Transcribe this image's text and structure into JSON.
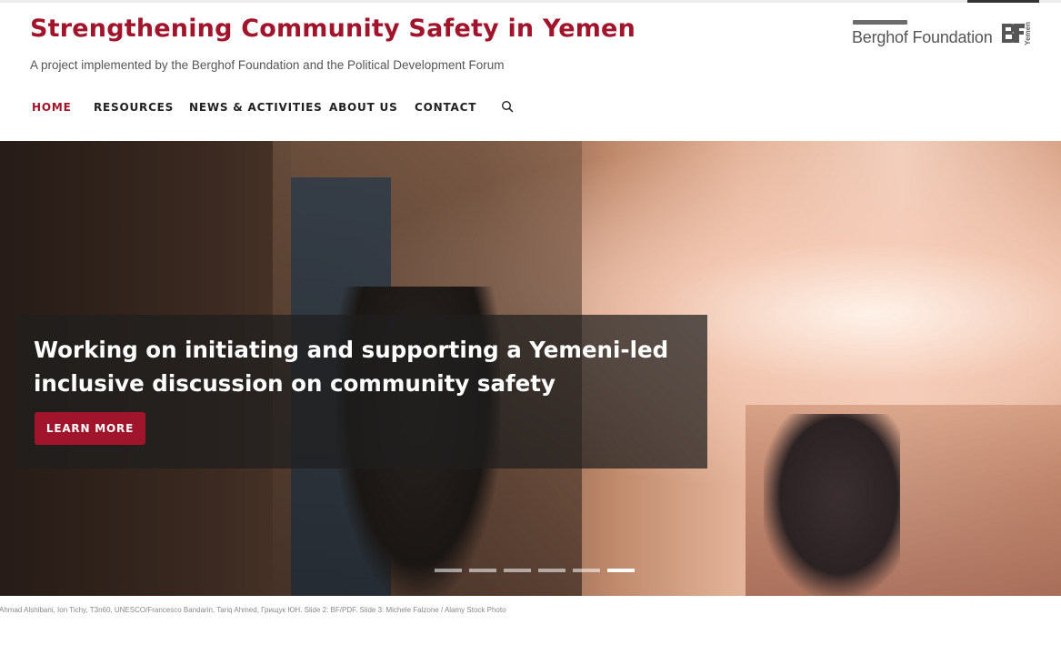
{
  "site": {
    "title": "Strengthening Community Safety in Yemen",
    "tagline": "A project implemented by the Berghof Foundation and the Political Development Forum",
    "logo_text": "Berghof Foundation",
    "logo_sub": "Yemen"
  },
  "nav": {
    "items": [
      {
        "label": "HOME",
        "active": true
      },
      {
        "label": "RESOURCES",
        "active": false
      },
      {
        "label": "NEWS & ACTIVITIES",
        "active": false
      },
      {
        "label": "ABOUT US",
        "active": false
      },
      {
        "label": "CONTACT",
        "active": false
      }
    ],
    "search_icon": "search-icon"
  },
  "hero": {
    "caption": "Working on initiating and supporting a Yemeni-led inclusive discussion on community safety",
    "button_label": "LEARN MORE",
    "slide_count": 6,
    "active_slide": 6
  },
  "credits": "Ahmad Alshibani, Ion Tichy, T3n60, UNESCO/Francesco Bandarin, Tariq Ahmed, Грищук ЮН. Slide 2: BF/PDF. Slide 3: Michele Falzone / Alamy Stock Photo",
  "colors": {
    "brand": "#a0152b",
    "nav_text": "#222222",
    "tagline": "#555555"
  }
}
